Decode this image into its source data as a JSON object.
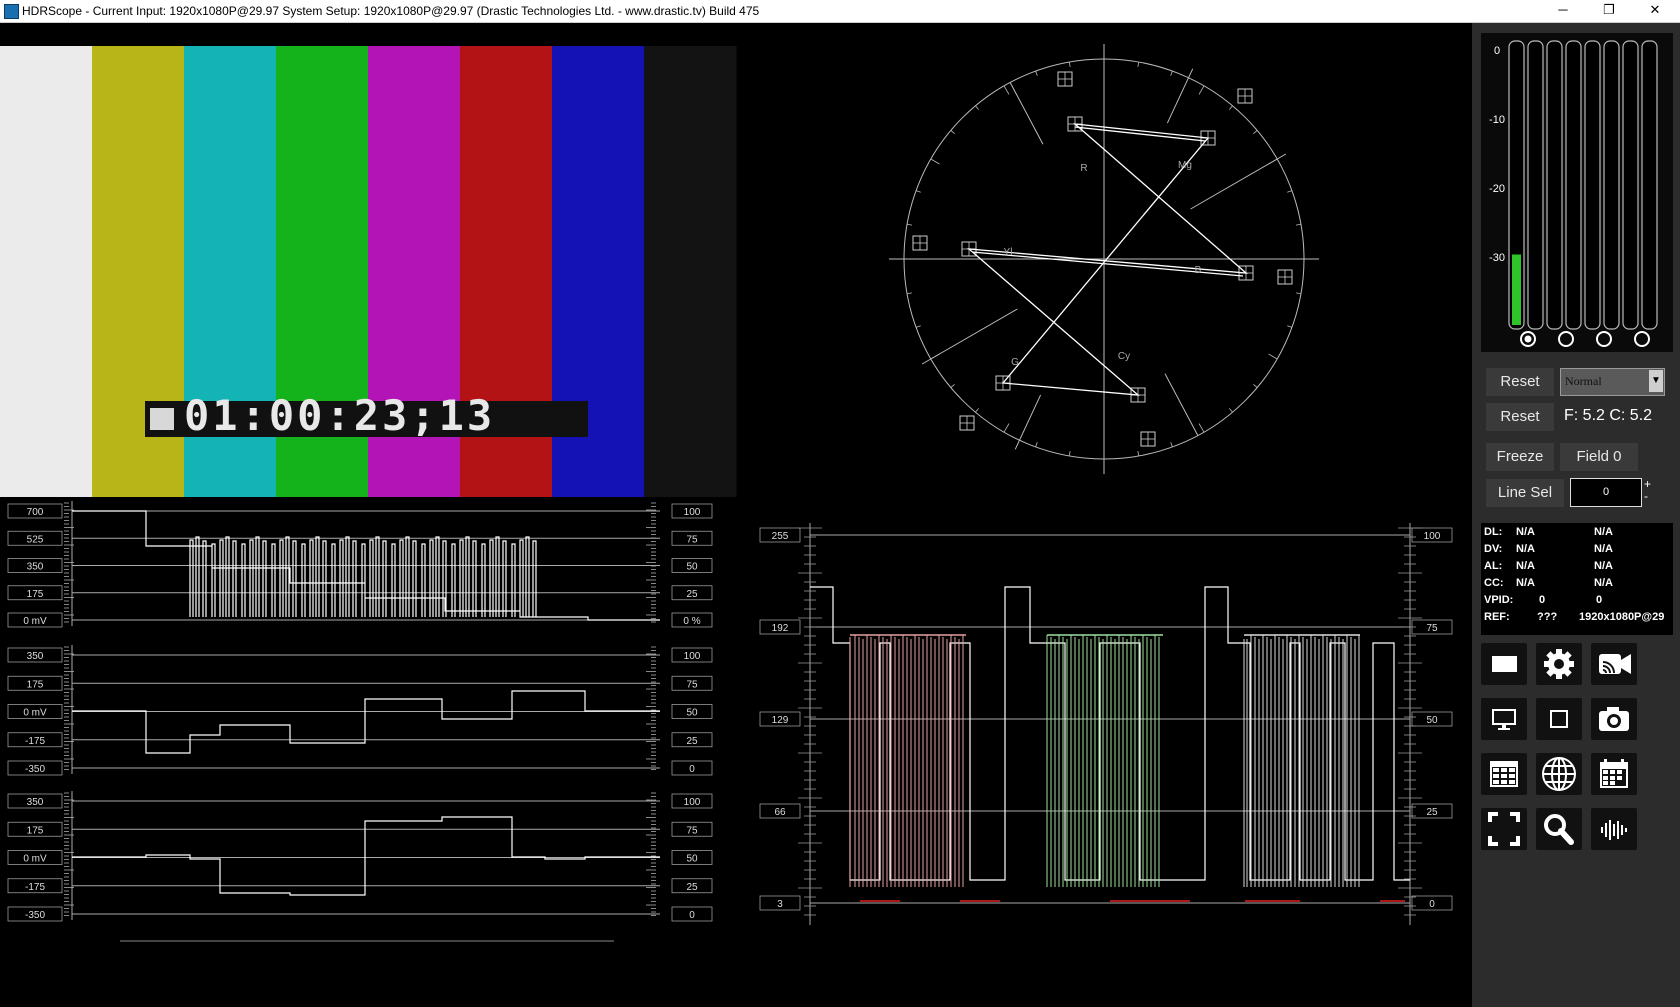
{
  "window": {
    "title": "HDRScope -   Current Input: 1920x1080P@29.97   System Setup: 1920x1080P@29.97     (Drastic Technologies Ltd. - www.drastic.tv) Build 475",
    "minimize": "─",
    "maximize": "❐",
    "close": "✕"
  },
  "video": {
    "bar_colors": [
      "#ebebeb",
      "#b7b517",
      "#14b3b5",
      "#15b31b",
      "#b314b5",
      "#b31315",
      "#1512b5",
      "#131313"
    ],
    "timecode": "01:00:23;13"
  },
  "waveform_left": {
    "panel1": {
      "left_labels": [
        "700",
        "525",
        "350",
        "175",
        "0 mV"
      ],
      "right_labels": [
        "100",
        "75",
        "50",
        "25",
        "0 %"
      ]
    },
    "panel2": {
      "left_labels": [
        "350",
        "175",
        "0 mV",
        "-175",
        "-350"
      ],
      "right_labels": [
        "100",
        "75",
        "50",
        "25",
        "0"
      ]
    },
    "panel3": {
      "left_labels": [
        "350",
        "175",
        "0 mV",
        "-175",
        "-350"
      ],
      "right_labels": [
        "100",
        "75",
        "50",
        "25",
        "0"
      ]
    }
  },
  "vectorscope": {
    "labels": [
      "R",
      "Mg",
      "B",
      "Cy",
      "G",
      "Yl"
    ]
  },
  "rgb_parade": {
    "left_labels": [
      "255",
      "192",
      "129",
      "66",
      "3"
    ],
    "right_labels": [
      "100",
      "75",
      "50",
      "25",
      "0"
    ]
  },
  "meters": {
    "scale": [
      "0",
      "-10",
      "-20",
      "-30"
    ],
    "level_fraction": 0.25,
    "channel_count": 8
  },
  "controls": {
    "reset1": "Reset",
    "mode": "Normal",
    "reset2": "Reset",
    "fc_readout": "F: 5.2  C: 5.2",
    "freeze": "Freeze",
    "field": "Field 0",
    "line_sel": "Line Sel",
    "line_value": "0",
    "plus": "+",
    "minus": "-"
  },
  "info": {
    "rows": [
      {
        "key": "DL:",
        "v1": "N/A",
        "v2": "N/A"
      },
      {
        "key": "DV:",
        "v1": "N/A",
        "v2": "N/A"
      },
      {
        "key": "AL:",
        "v1": "N/A",
        "v2": "N/A"
      },
      {
        "key": "CC:",
        "v1": "N/A",
        "v2": "N/A"
      },
      {
        "key": "VPID:",
        "v1": "0",
        "v2": "0"
      },
      {
        "key": "REF:",
        "v1": "???",
        "v2": "1920x1080P@29"
      }
    ]
  },
  "toolbar": {
    "icons": [
      "monitor-rect-icon",
      "gear-icon",
      "video-camera-icon",
      "display-icon",
      "square-icon",
      "camera-icon",
      "table-icon",
      "globe-icon",
      "calendar-icon",
      "fullscreen-icon",
      "search-icon",
      "audio-wave-icon"
    ]
  }
}
